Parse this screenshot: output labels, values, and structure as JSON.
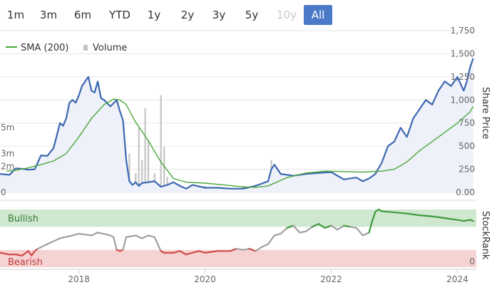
{
  "range_selector": {
    "buttons": [
      {
        "label": "1m",
        "state": "normal"
      },
      {
        "label": "3m",
        "state": "normal"
      },
      {
        "label": "6m",
        "state": "normal"
      },
      {
        "label": "YTD",
        "state": "normal"
      },
      {
        "label": "1y",
        "state": "normal"
      },
      {
        "label": "2y",
        "state": "normal"
      },
      {
        "label": "3y",
        "state": "normal"
      },
      {
        "label": "5y",
        "state": "normal"
      },
      {
        "label": "10y",
        "state": "disabled"
      },
      {
        "label": "All",
        "state": "active"
      }
    ]
  },
  "colors": {
    "price_line": "#3c68b0",
    "price_area": "#eef1f9",
    "sma_line": "#4aa83a",
    "volume": "#c4c4c4",
    "stockrank_line": "#a0a0a0",
    "bullish_line": "#3e9a3e",
    "bearish_line": "#d04a4a",
    "bullish_band": "#cfe8cf",
    "bearish_band": "#f6d3d3",
    "active_button": "#4a7ac8"
  },
  "chart_data": [
    {
      "type": "line",
      "panel": "price",
      "legend": {
        "items": [
          "SMA (200)",
          "Volume"
        ],
        "placement": "top-left"
      },
      "ylabel": "Share Price",
      "ylim": [
        0,
        1750
      ],
      "y_ticks": [
        "0.00",
        "250",
        "500",
        "750",
        "1,000",
        "1,250",
        "1,500",
        "1,750"
      ],
      "volume_axis": {
        "ticks": [
          "0",
          "2m",
          "3m",
          "5m"
        ],
        "values": [
          0,
          2,
          3,
          5
        ],
        "max": 12.5,
        "unit": "m"
      },
      "x_ticks": [
        "2018",
        "2020",
        "2022",
        "2024"
      ],
      "xlim": [
        2016.75,
        2024.3
      ],
      "series": [
        {
          "name": "Share Price",
          "x": [
            2016.75,
            2016.9,
            2017.0,
            2017.1,
            2017.2,
            2017.3,
            2017.4,
            2017.5,
            2017.6,
            2017.7,
            2017.75,
            2017.8,
            2017.85,
            2017.9,
            2017.95,
            2018.0,
            2018.05,
            2018.1,
            2018.15,
            2018.2,
            2018.25,
            2018.3,
            2018.35,
            2018.4,
            2018.5,
            2018.6,
            2018.65,
            2018.7,
            2018.75,
            2018.8,
            2018.85,
            2018.9,
            2018.95,
            2019.0,
            2019.1,
            2019.2,
            2019.3,
            2019.4,
            2019.5,
            2019.6,
            2019.7,
            2019.8,
            2020.0,
            2020.2,
            2020.4,
            2020.6,
            2020.8,
            2021.0,
            2021.05,
            2021.1,
            2021.2,
            2021.4,
            2021.6,
            2021.8,
            2022.0,
            2022.2,
            2022.4,
            2022.5,
            2022.6,
            2022.7,
            2022.8,
            2022.9,
            2023.0,
            2023.1,
            2023.2,
            2023.3,
            2023.4,
            2023.5,
            2023.6,
            2023.7,
            2023.8,
            2023.9,
            2024.0,
            2024.1,
            2024.15,
            2024.2,
            2024.25
          ],
          "y": [
            200,
            190,
            260,
            255,
            245,
            250,
            400,
            395,
            480,
            750,
            720,
            800,
            970,
            1000,
            970,
            1050,
            1150,
            1200,
            1250,
            1100,
            1080,
            1200,
            1020,
            1000,
            930,
            1000,
            880,
            780,
            350,
            120,
            80,
            110,
            70,
            100,
            110,
            120,
            60,
            80,
            110,
            70,
            40,
            80,
            50,
            50,
            40,
            40,
            70,
            120,
            250,
            300,
            200,
            180,
            200,
            210,
            220,
            140,
            160,
            120,
            150,
            200,
            320,
            500,
            550,
            700,
            600,
            800,
            900,
            1000,
            950,
            1100,
            1200,
            1150,
            1250,
            1100,
            1200,
            1350,
            1450
          ]
        },
        {
          "name": "SMA (200)",
          "x": [
            2016.85,
            2017.0,
            2017.2,
            2017.4,
            2017.6,
            2017.8,
            2018.0,
            2018.2,
            2018.4,
            2018.55,
            2018.65,
            2018.75,
            2018.9,
            2019.1,
            2019.3,
            2019.5,
            2019.7,
            2020.0,
            2020.3,
            2020.6,
            2020.8,
            2021.0,
            2021.3,
            2021.6,
            2021.9,
            2022.2,
            2022.5,
            2022.8,
            2023.0,
            2023.2,
            2023.4,
            2023.6,
            2023.8,
            2024.0,
            2024.2,
            2024.25
          ],
          "y": [
            230,
            240,
            265,
            300,
            340,
            420,
            600,
            800,
            950,
            1010,
            1000,
            950,
            760,
            560,
            330,
            150,
            110,
            100,
            80,
            60,
            55,
            70,
            160,
            210,
            230,
            225,
            220,
            230,
            250,
            330,
            450,
            550,
            650,
            750,
            870,
            930
          ]
        }
      ],
      "volume": {
        "x": [
          2016.8,
          2017.0,
          2017.3,
          2017.6,
          2017.9,
          2018.1,
          2018.4,
          2018.7,
          2018.8,
          2018.9,
          2018.95,
          2019.0,
          2019.05,
          2019.1,
          2019.2,
          2019.3,
          2019.35,
          2019.4,
          2019.5,
          2019.6,
          2019.8,
          2020.0,
          2020.2,
          2020.4,
          2020.6,
          2020.8,
          2021.0,
          2021.05,
          2021.1,
          2021.3,
          2021.6,
          2021.9,
          2022.2,
          2022.5,
          2022.8,
          2022.9,
          2023.0,
          2023.1,
          2023.2,
          2023.3,
          2023.5,
          2023.7,
          2023.9,
          2024.05,
          2024.1,
          2024.2
        ],
        "values": [
          0.3,
          0.5,
          0.4,
          0.6,
          0.5,
          0.8,
          0.7,
          1.2,
          3.0,
          1.5,
          5.0,
          2.5,
          6.5,
          4.0,
          1.5,
          7.5,
          3.5,
          1.2,
          0.8,
          0.6,
          0.4,
          0.5,
          0.4,
          0.3,
          0.5,
          0.6,
          0.9,
          2.5,
          1.5,
          0.8,
          0.7,
          0.6,
          0.5,
          0.6,
          1.2,
          2.0,
          1.5,
          2.2,
          1.8,
          2.5,
          1.5,
          1.2,
          1.0,
          2.0,
          1.5,
          1.0
        ]
      }
    },
    {
      "type": "line",
      "panel": "stockrank",
      "ylabel": "StockRank",
      "ylim": [
        0,
        100
      ],
      "y_ticks": [
        "0"
      ],
      "bands": {
        "upper_label": "Bullish",
        "lower_label": "Bearish",
        "upper_range": [
          70,
          100
        ],
        "lower_range": [
          0,
          30
        ]
      },
      "series": [
        {
          "name": "StockRank",
          "x": [
            2016.75,
            2016.9,
            2017.0,
            2017.1,
            2017.2,
            2017.25,
            2017.3,
            2017.35,
            2017.5,
            2017.7,
            2017.9,
            2018.0,
            2018.2,
            2018.3,
            2018.5,
            2018.55,
            2018.6,
            2018.65,
            2018.7,
            2018.75,
            2018.9,
            2019.0,
            2019.1,
            2019.2,
            2019.3,
            2019.35,
            2019.5,
            2019.6,
            2019.7,
            2019.8,
            2019.9,
            2020.0,
            2020.2,
            2020.4,
            2020.5,
            2020.6,
            2020.7,
            2020.8,
            2020.9,
            2021.0,
            2021.1,
            2021.2,
            2021.3,
            2021.4,
            2021.5,
            2021.6,
            2021.7,
            2021.8,
            2021.9,
            2022.0,
            2022.1,
            2022.2,
            2022.3,
            2022.4,
            2022.5,
            2022.6,
            2022.65,
            2022.7,
            2022.75,
            2022.8,
            2023.0,
            2023.2,
            2023.4,
            2023.6,
            2023.8,
            2024.0,
            2024.1,
            2024.2,
            2024.25
          ],
          "y": [
            25,
            22,
            22,
            20,
            28,
            20,
            28,
            32,
            40,
            50,
            55,
            58,
            55,
            60,
            55,
            52,
            30,
            28,
            30,
            52,
            55,
            50,
            55,
            52,
            28,
            25,
            25,
            28,
            22,
            25,
            28,
            25,
            28,
            28,
            32,
            30,
            32,
            28,
            35,
            40,
            55,
            58,
            68,
            72,
            60,
            62,
            70,
            75,
            68,
            72,
            65,
            72,
            70,
            68,
            55,
            60,
            80,
            96,
            100,
            97,
            95,
            93,
            90,
            88,
            85,
            82,
            80,
            82,
            80
          ]
        }
      ],
      "x_ticks": [
        "2018",
        "2020",
        "2022",
        "2024"
      ],
      "xlim": [
        2016.75,
        2024.3
      ]
    }
  ]
}
